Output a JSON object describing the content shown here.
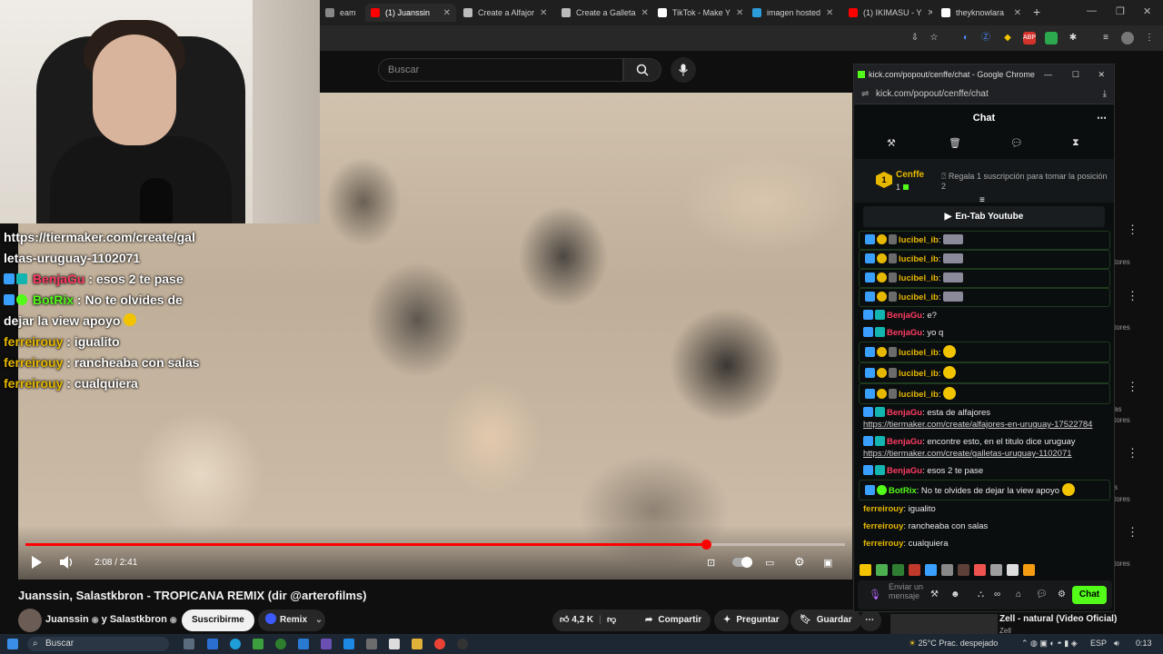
{
  "browser": {
    "tabs": [
      {
        "label": "eam",
        "color": "#888888"
      },
      {
        "label": "(1) Juanssin",
        "color": "#ff0000",
        "active": true
      },
      {
        "label": "Create a Alfajor",
        "color": "#bbbbbb"
      },
      {
        "label": "Create a Galleta",
        "color": "#bbbbbb"
      },
      {
        "label": "TikTok - Make Y",
        "color": "#ffffff"
      },
      {
        "label": "imagen hosted",
        "color": "#2d9cdb"
      },
      {
        "label": "(1) IKIMASU - Y",
        "color": "#ff0000"
      },
      {
        "label": "theyknowlara",
        "color": "#ffffff"
      }
    ],
    "new_tab": "+"
  },
  "youtube": {
    "search_placeholder": "Buscar",
    "player": {
      "time": "2:08 / 2:41",
      "progress": 0.83
    },
    "title": "Juanssin, Salastkbron - TROPICANA REMIX (dir @arterofilms)",
    "channel": "Juanssin",
    "channel_suffix": "y Salastkbron",
    "subscribe": "Suscribirme",
    "remix": "Remix",
    "likes": "4,2 K",
    "share": "Compartir",
    "ask": "Preguntar",
    "save": "Guardar",
    "side_labels": [
      "tores",
      "tores",
      "as",
      "tores",
      "s",
      "tores",
      "tores"
    ],
    "next_video_title": "Zell - natural (Video Oficial)",
    "next_video_channel": "Zell"
  },
  "overlay_chat": {
    "line1": "https://tiermaker.com/create/gal",
    "line2": "letas-uruguay-1102071",
    "m1_user": "BenjaGu",
    "m1_text": " : esos 2 te pase",
    "m2_user": "BotRix",
    "m2_text": " : No te olvides de",
    "m2_cont": "dejar la view apoyo",
    "m3_user": "ferreirouy",
    "m3_text": " : igualito",
    "m4_user": "ferreirouy",
    "m4_text": " : rancheaba con salas",
    "m5_user": "ferreirouy",
    "m5_text": " : cualquiera"
  },
  "popout": {
    "window_title": "kick.com/popout/cenffe/chat - Google Chrome",
    "url": "kick.com/popout/cenffe/chat",
    "header": "Chat",
    "pinned_name": "Cenffe",
    "pinned_sub": "1",
    "pinned_badge": "1",
    "pinned_text": "Regala 1 suscripción para tomar la posición 2",
    "en_tab": "En-Tab Youtube",
    "input_placeholder": "Enviar un mensaje",
    "send": "Chat",
    "messages": [
      {
        "user": "lucibel_ib",
        "color": "#e6b800",
        "text": "",
        "badges": [
          "blue",
          "gold",
          "feather"
        ],
        "emote": "grey",
        "hl": true
      },
      {
        "user": "lucibel_ib",
        "color": "#e6b800",
        "text": "",
        "badges": [
          "blue",
          "gold",
          "feather"
        ],
        "emote": "grey",
        "hl": true
      },
      {
        "user": "lucibel_ib",
        "color": "#e6b800",
        "text": "",
        "badges": [
          "blue",
          "gold",
          "feather"
        ],
        "emote": "grey",
        "hl": true
      },
      {
        "user": "lucibel_ib",
        "color": "#e6b800",
        "text": "",
        "badges": [
          "blue",
          "gold",
          "feather"
        ],
        "emote": "grey",
        "hl": true
      },
      {
        "user": "BenjaGu",
        "color": "#ff3c64",
        "text": " e?",
        "badges": [
          "blue",
          "teal"
        ]
      },
      {
        "user": "BenjaGu",
        "color": "#ff3c64",
        "text": " yo q",
        "badges": [
          "blue",
          "teal"
        ]
      },
      {
        "user": "lucibel_ib",
        "color": "#e6b800",
        "text": "",
        "badges": [
          "blue",
          "gold",
          "feather"
        ],
        "emote": "yellow",
        "hl": true
      },
      {
        "user": "lucibel_ib",
        "color": "#e6b800",
        "text": "",
        "badges": [
          "blue",
          "gold",
          "feather"
        ],
        "emote": "yellow",
        "hl": true
      },
      {
        "user": "lucibel_ib",
        "color": "#e6b800",
        "text": "",
        "badges": [
          "blue",
          "gold",
          "feather"
        ],
        "emote": "yellow",
        "hl": true
      },
      {
        "user": "BenjaGu",
        "color": "#ff3c64",
        "text": " esta de alfajores",
        "badges": [
          "blue",
          "teal"
        ],
        "link": "https://tiermaker.com/create/alfajores-en-uruguay-17522784"
      },
      {
        "user": "BenjaGu",
        "color": "#ff3c64",
        "text": " encontre esto, en el titulo dice uruguay",
        "badges": [
          "blue",
          "teal"
        ],
        "link": "https://tiermaker.com/create/galletas-uruguay-1102071"
      },
      {
        "user": "BenjaGu",
        "color": "#ff3c64",
        "text": " esos 2 te pase",
        "badges": [
          "blue",
          "teal"
        ]
      },
      {
        "user": "BotRix",
        "color": "#53fc18",
        "text": " No te olvides de dejar la view apoyo",
        "badges": [
          "blue",
          "green"
        ],
        "emote": "yellow",
        "hl": true
      },
      {
        "user": "ferreirouy",
        "color": "#e6b800",
        "text": " igualito",
        "badges": []
      },
      {
        "user": "ferreirouy",
        "color": "#e6b800",
        "text": " rancheaba con salas",
        "badges": []
      },
      {
        "user": "ferreirouy",
        "color": "#e6b800",
        "text": " cualquiera",
        "badges": []
      }
    ]
  },
  "taskbar": {
    "search": "Buscar",
    "weather": "25°C  Prac. despejado",
    "lang": "ESP",
    "time": "0:13"
  },
  "colors": {
    "kick_green": "#53fc18",
    "yt_red": "#ff0000",
    "badge_gold": "#e6b800"
  }
}
